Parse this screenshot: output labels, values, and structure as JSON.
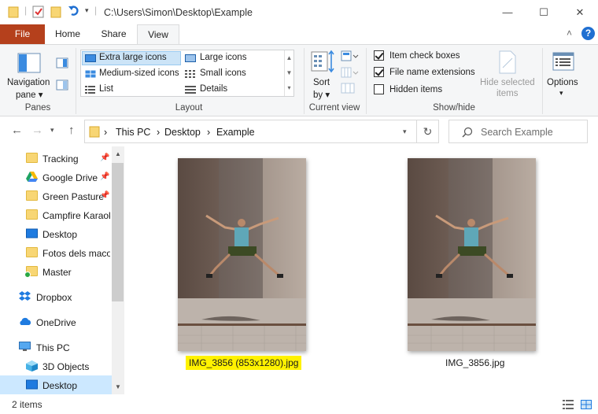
{
  "window": {
    "title": "C:\\Users\\Simon\\Desktop\\Example",
    "minimize": "—",
    "maximize": "☐",
    "close": "✕"
  },
  "ribbon_tabs": [
    {
      "label": "File",
      "active": false
    },
    {
      "label": "Home",
      "active": false
    },
    {
      "label": "Share",
      "active": false
    },
    {
      "label": "View",
      "active": true
    }
  ],
  "ribbon": {
    "panes": {
      "navigation_pane": "Navigation",
      "navigation_pane2": "pane ▾",
      "group": "Panes"
    },
    "layout": {
      "group": "Layout",
      "options": [
        "Extra large icons",
        "Large icons",
        "Medium-sized icons",
        "Small icons",
        "List",
        "Details"
      ],
      "selected": "Extra large icons"
    },
    "current_view": {
      "sort_by": "Sort",
      "sort_by2": "by ▾",
      "group": "Current view"
    },
    "show_hide": {
      "group": "Show/hide",
      "item_check_boxes": {
        "label": "Item check boxes",
        "checked": true
      },
      "file_name_extensions": {
        "label": "File name extensions",
        "checked": true
      },
      "hidden_items": {
        "label": "Hidden items",
        "checked": false
      },
      "hide_selected": "Hide selected",
      "hide_selected2": "items"
    },
    "options": {
      "label": "Options",
      "arrow": "▾"
    }
  },
  "address": {
    "crumbs": [
      "This PC",
      "Desktop",
      "Example"
    ],
    "separator": "›",
    "search_placeholder": "Search Example"
  },
  "nav_pane": {
    "items": [
      {
        "label": "Tracking",
        "icon": "folder-icon",
        "pinned": true
      },
      {
        "label": "Google Drive",
        "icon": "google-drive-icon",
        "pinned": true
      },
      {
        "label": "Green Pasture",
        "icon": "folder-icon",
        "pinned": true
      },
      {
        "label": "Campfire Karaok",
        "icon": "folder-icon",
        "pinned": false
      },
      {
        "label": "Desktop",
        "icon": "desktop-icon",
        "pinned": false
      },
      {
        "label": "Fotos dels maco",
        "icon": "folder-icon",
        "pinned": false
      },
      {
        "label": "Master",
        "icon": "folder-sync-icon",
        "pinned": false
      },
      {
        "label": "Dropbox",
        "icon": "dropbox-icon",
        "pinned": false
      },
      {
        "label": "OneDrive",
        "icon": "onedrive-icon",
        "pinned": false
      },
      {
        "label": "This PC",
        "icon": "pc-icon",
        "pinned": false
      },
      {
        "label": "3D Objects",
        "icon": "3d-objects-icon",
        "pinned": false
      },
      {
        "label": "Desktop",
        "icon": "desktop-icon",
        "pinned": false,
        "selected": true
      }
    ]
  },
  "files": [
    {
      "name": "IMG_3856 (853x1280).jpg",
      "highlighted": true
    },
    {
      "name": "IMG_3856.jpg",
      "highlighted": false
    }
  ],
  "status": {
    "text": "2 items"
  },
  "colors": {
    "file_tab": "#b5401c",
    "selection": "#cce8ff",
    "highlight": "#fff200",
    "accent": "#0078d7"
  }
}
